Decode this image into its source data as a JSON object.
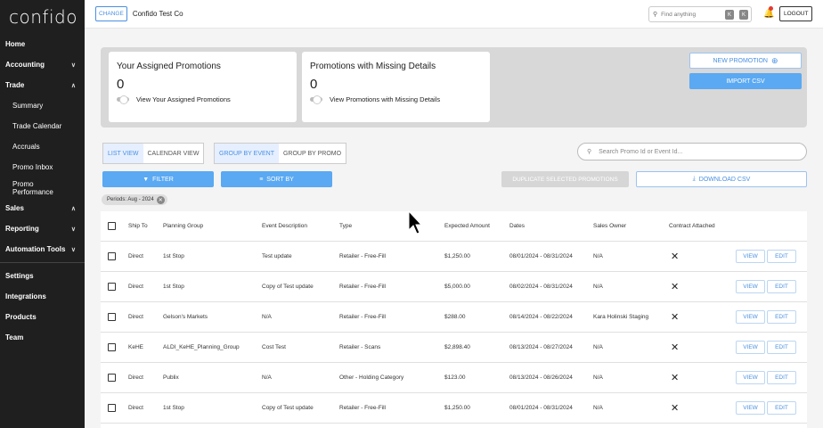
{
  "app": {
    "logo": "confido"
  },
  "sidebar": {
    "items": [
      {
        "label": "Home",
        "chevron": ""
      },
      {
        "label": "Accounting",
        "chevron": "down"
      },
      {
        "label": "Trade",
        "chevron": "up"
      }
    ],
    "trade_sub": [
      "Summary",
      "Trade Calendar",
      "Accruals",
      "Promo Inbox",
      "Promo Performance"
    ],
    "items2": [
      {
        "label": "Sales",
        "chevron": "up"
      },
      {
        "label": "Reporting",
        "chevron": "down"
      },
      {
        "label": "Automation Tools",
        "chevron": "down"
      }
    ],
    "items3": [
      "Settings",
      "Integrations",
      "Products",
      "Team"
    ]
  },
  "topbar": {
    "change_label": "CHANGE",
    "company": "Confido Test Co",
    "search_placeholder": "Find anything",
    "kbd1": "K",
    "kbd2": "K",
    "logout_label": "LOGOUT"
  },
  "cards": [
    {
      "title": "Your Assigned Promotions",
      "count": "0",
      "toggle_label": "View Your Assigned Promotions"
    },
    {
      "title": "Promotions with Missing Details",
      "count": "0",
      "toggle_label": "View Promotions with Missing Details"
    }
  ],
  "actions": {
    "new_promotion": "NEW PROMOTION",
    "import_csv": "IMPORT CSV",
    "list_view": "LIST VIEW",
    "calendar_view": "CALENDAR VIEW",
    "group_by_event": "GROUP BY EVENT",
    "group_by_promo": "GROUP BY PROMO",
    "search_placeholder": "Search Promo Id or Event Id...",
    "filter": "FILTER",
    "sort_by": "SORT BY",
    "duplicate": "DUPLICATE SELECTED PROMOTIONS",
    "download_csv": "DOWNLOAD CSV",
    "chip": "Periods: Aug - 2024"
  },
  "table": {
    "headers": [
      "Ship To",
      "Planning Group",
      "Event Description",
      "Type",
      "Expected Amount",
      "Dates",
      "Sales Owner",
      "Contract Attached"
    ],
    "view_label": "VIEW",
    "edit_label": "EDIT",
    "rows": [
      [
        "Direct",
        "1st Stop",
        "Test update",
        "Retailer - Free-Fill",
        "$1,250.00",
        "08/01/2024 - 08/31/2024",
        "N/A"
      ],
      [
        "Direct",
        "1st Stop",
        "Copy of Test update",
        "Retailer - Free-Fill",
        "$5,000.00",
        "08/02/2024 - 08/31/2024",
        "N/A"
      ],
      [
        "Direct",
        "Gelson's Markets",
        "N/A",
        "Retailer - Free-Fill",
        "$288.00",
        "08/14/2024 - 08/22/2024",
        "Kara Holinski Staging"
      ],
      [
        "KeHE",
        "ALDI_KeHE_Planning_Group",
        "Cost Test",
        "Retailer - Scans",
        "$2,898.40",
        "08/13/2024 - 08/27/2024",
        "N/A"
      ],
      [
        "Direct",
        "Publix",
        "N/A",
        "Other - Holding Category",
        "$123.00",
        "08/13/2024 - 08/26/2024",
        "N/A"
      ],
      [
        "Direct",
        "1st Stop",
        "Copy of Test update",
        "Retailer - Free-Fill",
        "$1,250.00",
        "08/01/2024 - 08/31/2024",
        "N/A"
      ]
    ]
  }
}
